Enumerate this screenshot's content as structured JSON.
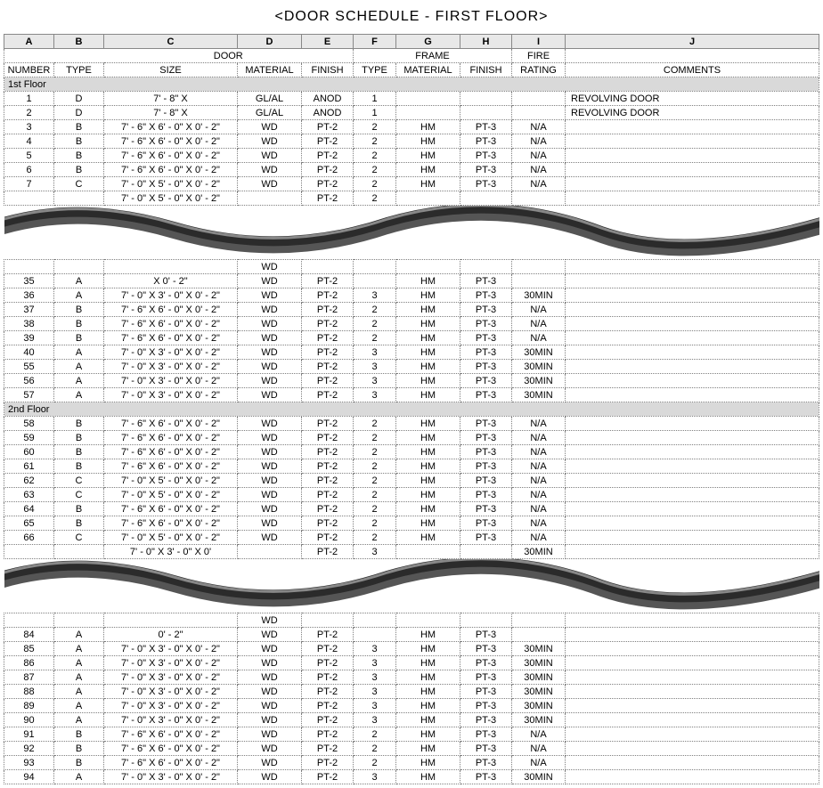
{
  "title": "<DOOR SCHEDULE - FIRST FLOOR>",
  "columnLetters": [
    "A",
    "B",
    "C",
    "D",
    "E",
    "F",
    "G",
    "H",
    "I",
    "J"
  ],
  "groupHeaders": {
    "door": "DOOR",
    "frame": "FRAME",
    "fire": "FIRE"
  },
  "headers": {
    "number": "NUMBER",
    "type": "TYPE",
    "size": "SIZE",
    "material": "MATERIAL",
    "finish": "FINISH",
    "type2": "TYPE",
    "material2": "MATERIAL",
    "finish2": "FINISH",
    "rating": "RATING",
    "comments": "COMMENTS"
  },
  "sections": [
    {
      "label": "1st Floor",
      "rows": [
        {
          "n": "1",
          "t": "D",
          "s": "7' - 8\" X",
          "m": "GL/AL",
          "f": "ANOD",
          "t2": "1",
          "m2": "",
          "f2": "",
          "r": "",
          "c": "REVOLVING DOOR"
        },
        {
          "n": "2",
          "t": "D",
          "s": "7' - 8\" X",
          "m": "GL/AL",
          "f": "ANOD",
          "t2": "1",
          "m2": "",
          "f2": "",
          "r": "",
          "c": "REVOLVING DOOR"
        },
        {
          "n": "3",
          "t": "B",
          "s": "7' - 6\" X 6' - 0\" X 0' - 2\"",
          "m": "WD",
          "f": "PT-2",
          "t2": "2",
          "m2": "HM",
          "f2": "PT-3",
          "r": "N/A",
          "c": ""
        },
        {
          "n": "4",
          "t": "B",
          "s": "7' - 6\" X 6' - 0\" X 0' - 2\"",
          "m": "WD",
          "f": "PT-2",
          "t2": "2",
          "m2": "HM",
          "f2": "PT-3",
          "r": "N/A",
          "c": ""
        },
        {
          "n": "5",
          "t": "B",
          "s": "7' - 6\" X 6' - 0\" X 0' - 2\"",
          "m": "WD",
          "f": "PT-2",
          "t2": "2",
          "m2": "HM",
          "f2": "PT-3",
          "r": "N/A",
          "c": ""
        },
        {
          "n": "6",
          "t": "B",
          "s": "7' - 6\" X 6' - 0\" X 0' - 2\"",
          "m": "WD",
          "f": "PT-2",
          "t2": "2",
          "m2": "HM",
          "f2": "PT-3",
          "r": "N/A",
          "c": ""
        },
        {
          "n": "7",
          "t": "C",
          "s": "7' - 0\" X 5' - 0\" X 0' - 2\"",
          "m": "WD",
          "f": "PT-2",
          "t2": "2",
          "m2": "HM",
          "f2": "PT-3",
          "r": "N/A",
          "c": ""
        }
      ],
      "partialBottom": {
        "n": "",
        "t": "",
        "s": "7' - 0\" X 5' - 0\" X 0' - 2\"",
        "m": "",
        "f": "PT-2",
        "t2": "2",
        "m2": "",
        "f2": "",
        "r": "",
        "c": ""
      }
    },
    {
      "label": "",
      "partialTop": [
        {
          "n": "",
          "t": "",
          "s": "",
          "m": "WD",
          "f": "",
          "t2": "",
          "m2": "",
          "f2": "",
          "r": "",
          "c": ""
        },
        {
          "n": "35",
          "t": "A",
          "s": "X 0' - 2\"",
          "m": "WD",
          "f": "PT-2",
          "t2": "",
          "m2": "HM",
          "f2": "PT-3",
          "r": "",
          "c": ""
        }
      ],
      "rows": [
        {
          "n": "36",
          "t": "A",
          "s": "7' - 0\" X 3' - 0\" X 0' - 2\"",
          "m": "WD",
          "f": "PT-2",
          "t2": "3",
          "m2": "HM",
          "f2": "PT-3",
          "r": "30MIN",
          "c": ""
        },
        {
          "n": "37",
          "t": "B",
          "s": "7' - 6\" X 6' - 0\" X 0' - 2\"",
          "m": "WD",
          "f": "PT-2",
          "t2": "2",
          "m2": "HM",
          "f2": "PT-3",
          "r": "N/A",
          "c": ""
        },
        {
          "n": "38",
          "t": "B",
          "s": "7' - 6\" X 6' - 0\" X 0' - 2\"",
          "m": "WD",
          "f": "PT-2",
          "t2": "2",
          "m2": "HM",
          "f2": "PT-3",
          "r": "N/A",
          "c": ""
        },
        {
          "n": "39",
          "t": "B",
          "s": "7' - 6\" X 6' - 0\" X 0' - 2\"",
          "m": "WD",
          "f": "PT-2",
          "t2": "2",
          "m2": "HM",
          "f2": "PT-3",
          "r": "N/A",
          "c": ""
        },
        {
          "n": "40",
          "t": "A",
          "s": "7' - 0\" X 3' - 0\" X 0' - 2\"",
          "m": "WD",
          "f": "PT-2",
          "t2": "3",
          "m2": "HM",
          "f2": "PT-3",
          "r": "30MIN",
          "c": ""
        },
        {
          "n": "55",
          "t": "A",
          "s": "7' - 0\" X 3' - 0\" X 0' - 2\"",
          "m": "WD",
          "f": "PT-2",
          "t2": "3",
          "m2": "HM",
          "f2": "PT-3",
          "r": "30MIN",
          "c": ""
        },
        {
          "n": "56",
          "t": "A",
          "s": "7' - 0\" X 3' - 0\" X 0' - 2\"",
          "m": "WD",
          "f": "PT-2",
          "t2": "3",
          "m2": "HM",
          "f2": "PT-3",
          "r": "30MIN",
          "c": ""
        },
        {
          "n": "57",
          "t": "A",
          "s": "7' - 0\" X 3' - 0\" X 0' - 2\"",
          "m": "WD",
          "f": "PT-2",
          "t2": "3",
          "m2": "HM",
          "f2": "PT-3",
          "r": "30MIN",
          "c": ""
        }
      ]
    },
    {
      "label": "2nd Floor",
      "rows": [
        {
          "n": "58",
          "t": "B",
          "s": "7' - 6\" X 6' - 0\" X 0' - 2\"",
          "m": "WD",
          "f": "PT-2",
          "t2": "2",
          "m2": "HM",
          "f2": "PT-3",
          "r": "N/A",
          "c": ""
        },
        {
          "n": "59",
          "t": "B",
          "s": "7' - 6\" X 6' - 0\" X 0' - 2\"",
          "m": "WD",
          "f": "PT-2",
          "t2": "2",
          "m2": "HM",
          "f2": "PT-3",
          "r": "N/A",
          "c": ""
        },
        {
          "n": "60",
          "t": "B",
          "s": "7' - 6\" X 6' - 0\" X 0' - 2\"",
          "m": "WD",
          "f": "PT-2",
          "t2": "2",
          "m2": "HM",
          "f2": "PT-3",
          "r": "N/A",
          "c": ""
        },
        {
          "n": "61",
          "t": "B",
          "s": "7' - 6\" X 6' - 0\" X 0' - 2\"",
          "m": "WD",
          "f": "PT-2",
          "t2": "2",
          "m2": "HM",
          "f2": "PT-3",
          "r": "N/A",
          "c": ""
        },
        {
          "n": "62",
          "t": "C",
          "s": "7' - 0\" X 5' - 0\" X 0' - 2\"",
          "m": "WD",
          "f": "PT-2",
          "t2": "2",
          "m2": "HM",
          "f2": "PT-3",
          "r": "N/A",
          "c": ""
        },
        {
          "n": "63",
          "t": "C",
          "s": "7' - 0\" X 5' - 0\" X 0' - 2\"",
          "m": "WD",
          "f": "PT-2",
          "t2": "2",
          "m2": "HM",
          "f2": "PT-3",
          "r": "N/A",
          "c": ""
        },
        {
          "n": "64",
          "t": "B",
          "s": "7' - 6\" X 6' - 0\" X 0' - 2\"",
          "m": "WD",
          "f": "PT-2",
          "t2": "2",
          "m2": "HM",
          "f2": "PT-3",
          "r": "N/A",
          "c": ""
        },
        {
          "n": "65",
          "t": "B",
          "s": "7' - 6\" X 6' - 0\" X 0' - 2\"",
          "m": "WD",
          "f": "PT-2",
          "t2": "2",
          "m2": "HM",
          "f2": "PT-3",
          "r": "N/A",
          "c": ""
        },
        {
          "n": "66",
          "t": "C",
          "s": "7' - 0\" X 5' - 0\" X 0' - 2\"",
          "m": "WD",
          "f": "PT-2",
          "t2": "2",
          "m2": "HM",
          "f2": "PT-3",
          "r": "N/A",
          "c": ""
        }
      ],
      "partialBottom": {
        "n": "",
        "t": "",
        "s": "7' - 0\" X 3' - 0\" X 0'",
        "m": "",
        "f": "PT-2",
        "t2": "3",
        "m2": "",
        "f2": "",
        "r": "30MIN",
        "c": ""
      }
    },
    {
      "label": "",
      "partialTop": [
        {
          "n": "",
          "t": "",
          "s": "",
          "m": "WD",
          "f": "",
          "t2": "",
          "m2": "",
          "f2": "",
          "r": "",
          "c": ""
        },
        {
          "n": "84",
          "t": "A",
          "s": "0' - 2\"",
          "m": "WD",
          "f": "PT-2",
          "t2": "",
          "m2": "HM",
          "f2": "PT-3",
          "r": "",
          "c": ""
        }
      ],
      "rows": [
        {
          "n": "85",
          "t": "A",
          "s": "7' - 0\" X 3' - 0\" X 0' - 2\"",
          "m": "WD",
          "f": "PT-2",
          "t2": "3",
          "m2": "HM",
          "f2": "PT-3",
          "r": "30MIN",
          "c": ""
        },
        {
          "n": "86",
          "t": "A",
          "s": "7' - 0\" X 3' - 0\" X 0' - 2\"",
          "m": "WD",
          "f": "PT-2",
          "t2": "3",
          "m2": "HM",
          "f2": "PT-3",
          "r": "30MIN",
          "c": ""
        },
        {
          "n": "87",
          "t": "A",
          "s": "7' - 0\" X 3' - 0\" X 0' - 2\"",
          "m": "WD",
          "f": "PT-2",
          "t2": "3",
          "m2": "HM",
          "f2": "PT-3",
          "r": "30MIN",
          "c": ""
        },
        {
          "n": "88",
          "t": "A",
          "s": "7' - 0\" X 3' - 0\" X 0' - 2\"",
          "m": "WD",
          "f": "PT-2",
          "t2": "3",
          "m2": "HM",
          "f2": "PT-3",
          "r": "30MIN",
          "c": ""
        },
        {
          "n": "89",
          "t": "A",
          "s": "7' - 0\" X 3' - 0\" X 0' - 2\"",
          "m": "WD",
          "f": "PT-2",
          "t2": "3",
          "m2": "HM",
          "f2": "PT-3",
          "r": "30MIN",
          "c": ""
        },
        {
          "n": "90",
          "t": "A",
          "s": "7' - 0\" X 3' - 0\" X 0' - 2\"",
          "m": "WD",
          "f": "PT-2",
          "t2": "3",
          "m2": "HM",
          "f2": "PT-3",
          "r": "30MIN",
          "c": ""
        },
        {
          "n": "91",
          "t": "B",
          "s": "7' - 6\" X 6' - 0\" X 0' - 2\"",
          "m": "WD",
          "f": "PT-2",
          "t2": "2",
          "m2": "HM",
          "f2": "PT-3",
          "r": "N/A",
          "c": ""
        },
        {
          "n": "92",
          "t": "B",
          "s": "7' - 6\" X 6' - 0\" X 0' - 2\"",
          "m": "WD",
          "f": "PT-2",
          "t2": "2",
          "m2": "HM",
          "f2": "PT-3",
          "r": "N/A",
          "c": ""
        },
        {
          "n": "93",
          "t": "B",
          "s": "7' - 6\" X 6' - 0\" X 0' - 2\"",
          "m": "WD",
          "f": "PT-2",
          "t2": "2",
          "m2": "HM",
          "f2": "PT-3",
          "r": "N/A",
          "c": ""
        },
        {
          "n": "94",
          "t": "A",
          "s": "7' - 0\" X 3' - 0\" X 0' - 2\"",
          "m": "WD",
          "f": "PT-2",
          "t2": "3",
          "m2": "HM",
          "f2": "PT-3",
          "r": "30MIN",
          "c": ""
        }
      ]
    }
  ]
}
